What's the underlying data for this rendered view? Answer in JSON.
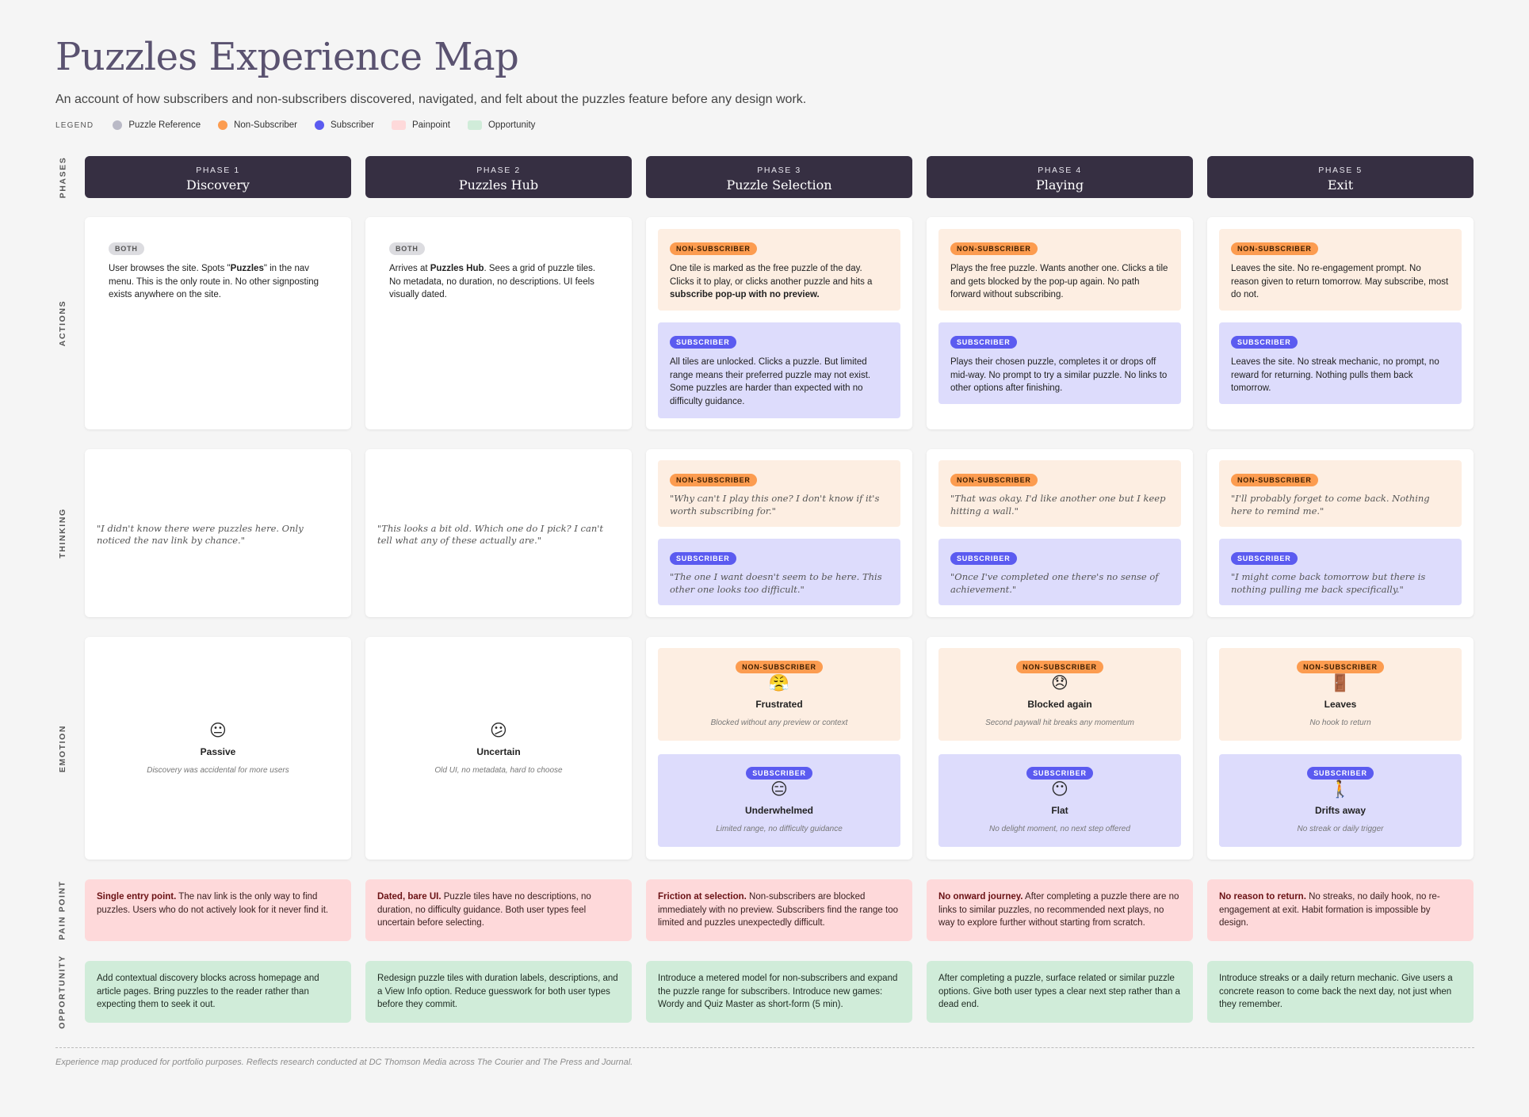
{
  "header": {
    "title": "Puzzles Experience Map",
    "subtitle": "An account of how subscribers and non-subscribers discovered, navigated, and felt about the puzzles feature before any design work."
  },
  "legend": {
    "label": "LEGEND",
    "items": [
      {
        "label": "Puzzle Reference",
        "color": "#b9b9c6"
      },
      {
        "label": "Non-Subscriber",
        "color": "#fc9c50"
      },
      {
        "label": "Subscriber",
        "color": "#5b5bf0"
      },
      {
        "label": "Painpoint",
        "color": "#fed9da"
      },
      {
        "label": "Opportunity",
        "color": "#d0ecd9"
      }
    ]
  },
  "rows": {
    "phases": "PHASES",
    "actions": "ACTIONS",
    "thinking": "THINKING",
    "emotion": "EMOTION",
    "pain": "PAIN POINT",
    "opportunity": "OPPORTUNITY"
  },
  "tags": {
    "both": "BOTH",
    "ns": "NON-SUBSCRIBER",
    "s": "SUBSCRIBER"
  },
  "phases": [
    {
      "number": "PHASE 1",
      "name": "Discovery",
      "actions": {
        "both": {
          "pre": "User browses the site. Spots \"",
          "bold": "Puzzles",
          "post": "\" in the nav menu. This is the only route in. No other signposting exists anywhere on the site."
        }
      },
      "thinking": {
        "both": "\"I didn't know there were puzzles here. Only noticed the nav link by chance.\""
      },
      "emotion": {
        "both": {
          "icon": "😐",
          "label": "Passive",
          "desc": "Discovery was accidental for more users"
        }
      },
      "pain": {
        "bold": "Single entry point.",
        "text": " The nav link is the only way to find puzzles. Users who do not actively look for it never find it."
      },
      "opportunity": "Add contextual discovery blocks across homepage and article pages. Bring puzzles to the reader rather than expecting them to seek it out."
    },
    {
      "number": "PHASE 2",
      "name": "Puzzles Hub",
      "actions": {
        "both": {
          "pre": "Arrives at ",
          "bold": "Puzzles Hub",
          "post": ". Sees a grid of puzzle tiles. No metadata, no duration, no descriptions. UI feels visually dated."
        }
      },
      "thinking": {
        "both": "\"This looks a bit old. Which one do I pick? I can't tell what any of these actually are.\""
      },
      "emotion": {
        "both": {
          "icon": "😕",
          "label": "Uncertain",
          "desc": "Old UI, no metadata, hard to choose"
        }
      },
      "pain": {
        "bold": "Dated, bare UI.",
        "text": " Puzzle tiles have no descriptions, no duration, no difficulty guidance. Both user types feel uncertain before selecting."
      },
      "opportunity": "Redesign puzzle tiles with duration labels, descriptions, and a View Info option. Reduce guesswork for both user types before they commit."
    },
    {
      "number": "PHASE 3",
      "name": "Puzzle Selection",
      "actions": {
        "ns": {
          "pre": "One tile is marked as the free puzzle of the day. Clicks it to play, or clicks another puzzle and hits a ",
          "bold": "subscribe pop-up with no preview.",
          "post": ""
        },
        "s": "All tiles are unlocked. Clicks a puzzle. But limited range means their preferred puzzle may not exist. Some puzzles are harder than expected with no difficulty guidance."
      },
      "thinking": {
        "ns": "\"Why can't I play this one? I don't know if it's worth subscribing for.\"",
        "s": "\"The one I want doesn't seem to be here. This other one looks too difficult.\""
      },
      "emotion": {
        "ns": {
          "icon": "😤",
          "label": "Frustrated",
          "desc": "Blocked without any preview or context"
        },
        "s": {
          "icon": "😑",
          "label": "Underwhelmed",
          "desc": "Limited range, no difficulty guidance"
        }
      },
      "pain": {
        "bold": "Friction at selection.",
        "text": " Non-subscribers are blocked immediately with no preview. Subscribers find the range too limited and puzzles unexpectedly difficult."
      },
      "opportunity": "Introduce a metered model for non-subscribers and expand the puzzle range for subscribers. Introduce new games: Wordy and Quiz Master as short-form (5 min)."
    },
    {
      "number": "PHASE 4",
      "name": "Playing",
      "actions": {
        "ns": {
          "pre": "Plays the free puzzle. Wants another one. Clicks a tile and gets blocked by the pop-up again. No path forward without subscribing.",
          "bold": "",
          "post": ""
        },
        "s": "Plays their chosen puzzle, completes it or drops off mid-way. No prompt to try a similar puzzle. No links to other options after finishing."
      },
      "thinking": {
        "ns": "\"That was okay. I'd like another one but I keep hitting a wall.\"",
        "s": "\"Once I've completed one there's no sense of achievement.\""
      },
      "emotion": {
        "ns": {
          "icon": "😞",
          "label": "Blocked again",
          "desc": "Second paywall hit breaks any momentum"
        },
        "s": {
          "icon": "😶",
          "label": "Flat",
          "desc": "No delight moment, no next step offered"
        }
      },
      "pain": {
        "bold": "No onward journey.",
        "text": " After completing a puzzle there are no links to similar puzzles, no recommended next plays, no way to explore further without starting from scratch."
      },
      "opportunity": "After completing a puzzle, surface related or similar puzzle options. Give both user types a clear next step rather than a dead end."
    },
    {
      "number": "PHASE 5",
      "name": "Exit",
      "actions": {
        "ns": {
          "pre": "Leaves the site. No re-engagement prompt. No reason given to return tomorrow. May subscribe, most do not.",
          "bold": "",
          "post": ""
        },
        "s": "Leaves the site. No streak mechanic, no prompt, no reward for returning. Nothing pulls them back tomorrow."
      },
      "thinking": {
        "ns": "\"I'll probably forget to come back. Nothing here to remind me.\"",
        "s": "\"I might come back tomorrow but there is nothing pulling me back specifically.\""
      },
      "emotion": {
        "ns": {
          "icon": "🚪",
          "label": "Leaves",
          "desc": "No hook to return"
        },
        "s": {
          "icon": "🚶",
          "label": "Drifts away",
          "desc": "No streak or daily trigger"
        }
      },
      "pain": {
        "bold": "No reason to return.",
        "text": " No streaks, no daily hook, no re-engagement at exit. Habit formation is impossible by design."
      },
      "opportunity": "Introduce streaks or a daily return mechanic. Give users a concrete reason to come back the next day, not just when they remember."
    }
  ],
  "footer": "Experience map produced for portfolio purposes. Reflects research conducted at DC Thomson Media across The Courier and The Press and Journal."
}
